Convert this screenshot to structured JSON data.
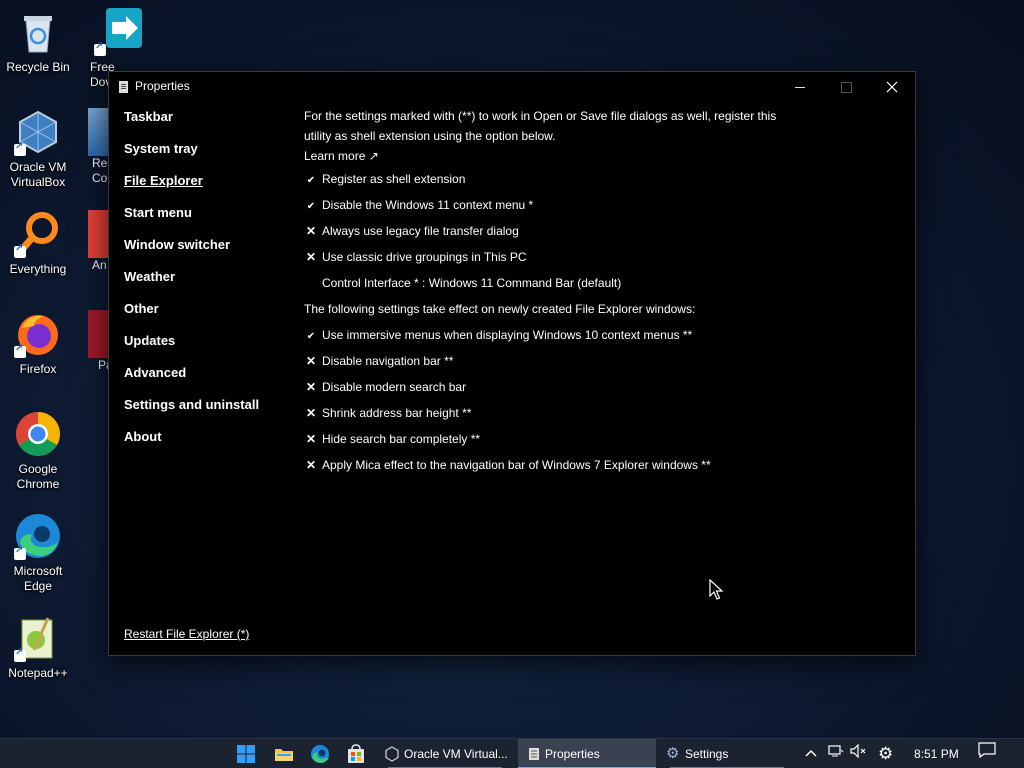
{
  "desktop": {
    "icons": [
      {
        "label": "Recycle Bin"
      },
      {
        "label": "Oracle VM\nVirtualBox"
      },
      {
        "label": "Everything"
      },
      {
        "label": "Firefox"
      },
      {
        "label": "Google\nChrome"
      },
      {
        "label": "Microsoft\nEdge"
      },
      {
        "label": "Notepad++"
      }
    ],
    "peek_icons": [
      {
        "label": "Free\nDov"
      },
      {
        "label": "Rec\nCo"
      },
      {
        "label": "An"
      },
      {
        "label": "Pa"
      }
    ]
  },
  "window": {
    "title": "Properties",
    "nav": [
      {
        "label": "Taskbar"
      },
      {
        "label": "System tray"
      },
      {
        "label": "File Explorer"
      },
      {
        "label": "Start menu"
      },
      {
        "label": "Window switcher"
      },
      {
        "label": "Weather"
      },
      {
        "label": "Other"
      },
      {
        "label": "Updates"
      },
      {
        "label": "Advanced"
      },
      {
        "label": "Settings and uninstall"
      },
      {
        "label": "About"
      }
    ],
    "active_nav": "File Explorer",
    "restart_link": "Restart File Explorer (*)",
    "content": {
      "intro": "For the settings marked with (**) to work in Open or Save file dialogs as well, register this utility as shell extension using the option below.",
      "learn_more": "Learn more ↗",
      "options_a": [
        {
          "label": "Register as shell extension",
          "state": "check"
        },
        {
          "label": "Disable the Windows 11 context menu *",
          "state": "check"
        },
        {
          "label": "Always use legacy file transfer dialog",
          "state": "cross"
        },
        {
          "label": "Use classic drive groupings in This PC",
          "state": "cross"
        },
        {
          "label": "Control Interface * : Windows 11 Command Bar (default)",
          "state": "none"
        }
      ],
      "section_b": "The following settings take effect on newly created File Explorer windows:",
      "options_b": [
        {
          "label": "Use immersive menus when displaying Windows 10 context menus **",
          "state": "check"
        },
        {
          "label": "Disable navigation bar **",
          "state": "cross"
        },
        {
          "label": "Disable modern search bar",
          "state": "cross"
        },
        {
          "label": "Shrink address bar height **",
          "state": "cross"
        },
        {
          "label": "Hide search bar completely **",
          "state": "cross"
        },
        {
          "label": "Apply Mica effect to the navigation bar of Windows 7 Explorer windows **",
          "state": "cross"
        }
      ]
    }
  },
  "taskbar": {
    "apps": [
      {
        "label": "Oracle VM Virtual..."
      },
      {
        "label": "Properties"
      },
      {
        "label": "Settings"
      }
    ],
    "clock": "8:51 PM"
  }
}
